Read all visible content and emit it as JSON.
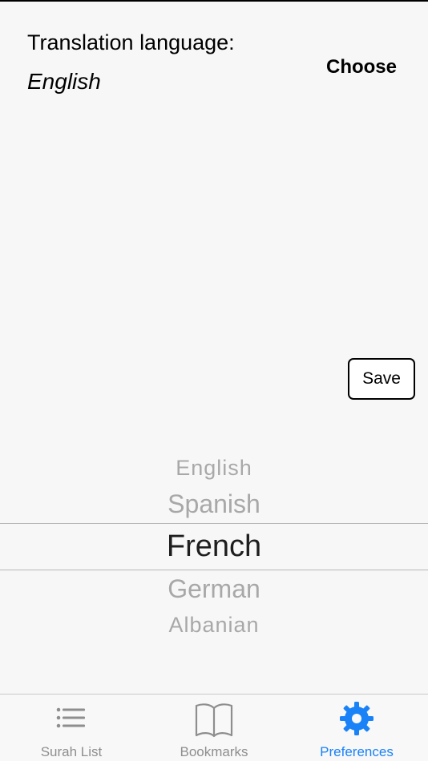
{
  "settings": {
    "label": "Translation language:",
    "value": "English",
    "choose_label": "Choose",
    "save_label": "Save"
  },
  "picker": {
    "options": [
      "English",
      "Spanish",
      "French",
      "German",
      "Albanian"
    ],
    "selected": "French"
  },
  "tabs": [
    {
      "label": "Surah List",
      "icon": "list-icon"
    },
    {
      "label": "Bookmarks",
      "icon": "book-icon"
    },
    {
      "label": "Preferences",
      "icon": "gear-icon",
      "active": true
    }
  ],
  "colors": {
    "accent": "#1a82f7",
    "background": "#f7f7f7",
    "inactive_tab": "#8e8e8e"
  }
}
